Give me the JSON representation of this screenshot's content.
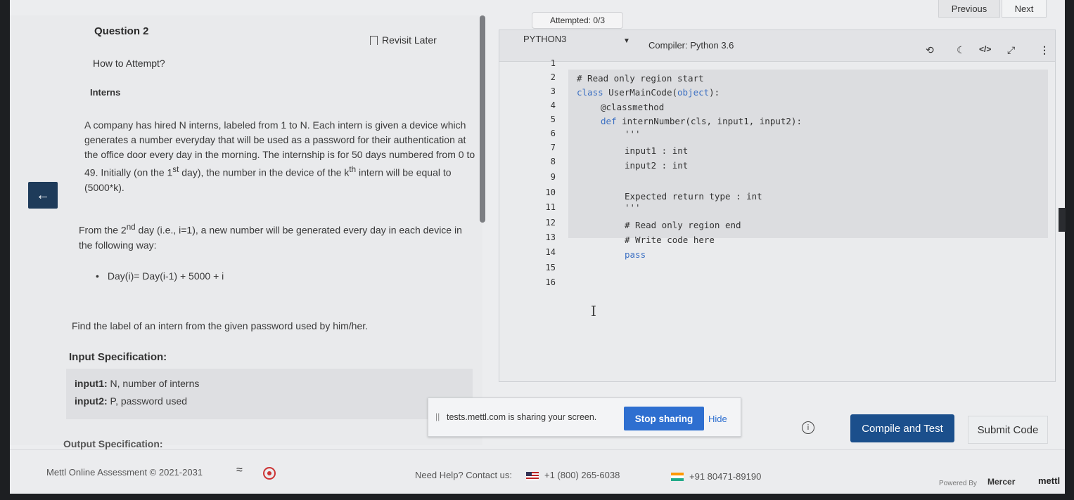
{
  "nav": {
    "previous": "Previous",
    "next": "Next",
    "attempted": "Attempted: 0/3"
  },
  "question": {
    "title": "Question 2",
    "revisit": "Revisit Later",
    "how_to": "How to Attempt?",
    "name": "Interns",
    "para1_a": "A company has hired N interns, labeled from 1 to N. Each intern is given a device which generates a number everyday that will be used as a password for their authentication at the office door every day in the morning. The internship is for 50 days numbered from 0 to 49. Initially (on the 1",
    "para1_sup1": "st",
    "para1_b": " day), the number in the device of the k",
    "para1_sup2": "th",
    "para1_c": " intern will be equal to (5000*k).",
    "para2_a": "From the 2",
    "para2_sup": "nd",
    "para2_b": " day (i.e., i=1), a new number will be generated every day in each device in the following way:",
    "bullet": "Day(i)= Day(i-1) + 5000 + i",
    "find": "Find the label of an intern from the given password used by him/her.",
    "input_spec": "Input Specification:",
    "input1_label": "input1:",
    "input1_text": " N, number of interns",
    "input2_label": "input2:",
    "input2_text": " P, password used",
    "output_spec": "Output Specification:"
  },
  "editor": {
    "language": "PYTHON3",
    "compiler": "Compiler: Python 3.6",
    "line_numbers": [
      "1",
      "2",
      "3",
      "4",
      "5",
      "6",
      "7",
      "8",
      "9",
      "10",
      "11",
      "12",
      "13",
      "14",
      "15",
      "16"
    ],
    "code": {
      "l2": "# Read only region start",
      "l3_kw": "class",
      "l3_a": " UserMainCode(",
      "l3_obj": "object",
      "l3_b": "):",
      "l4": "@classmethod",
      "l5_kw": "def",
      "l5": " internNumber(cls, input1, input2):",
      "l6": "'''",
      "l7": "input1 : int",
      "l8": "input2 : int",
      "l10": "Expected return type : int",
      "l11": "'''",
      "l12": "# Read only region end",
      "l13": "# Write code here",
      "l14": "pass"
    }
  },
  "share": {
    "text": "tests.mettl.com is sharing your screen.",
    "stop": "Stop sharing",
    "hide": "Hide"
  },
  "actions": {
    "compile": "Compile and Test",
    "submit": "Submit Code"
  },
  "footer": {
    "copyright": "Mettl Online Assessment © 2021-2031",
    "help": "Need Help? Contact us:",
    "us_phone": "+1 (800) 265-6038",
    "in_phone": "+91 80471-89190",
    "powered": "Powered By",
    "mercer": "Mercer",
    "mettl": "mettl"
  }
}
